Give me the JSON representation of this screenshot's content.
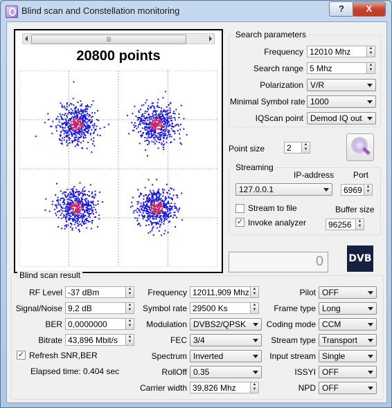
{
  "window": {
    "title": "Blind scan and Constellation monitoring",
    "help_glyph": "?",
    "close_glyph": "X"
  },
  "plot": {
    "points_label": "20800 points",
    "scroll_grip": "|||"
  },
  "search": {
    "group_title": "Search parameters",
    "frequency_label": "Frequency",
    "frequency_value": "12010 Mhz",
    "range_label": "Search range",
    "range_value": "5 Mhz",
    "polarization_label": "Polarization",
    "polarization_value": "V/R",
    "minsr_label": "Minimal Symbol rate",
    "minsr_value": "1000",
    "iqscan_label": "IQScan point",
    "iqscan_value": "Demod IQ out"
  },
  "point_size": {
    "label": "Point size",
    "value": "2"
  },
  "streaming": {
    "group_title": "Streaming",
    "ip_label": "IP-address",
    "port_label": "Port",
    "ip_value": "127.0.0.1",
    "port_value": "6969",
    "stream_to_file_label": "Stream to file",
    "stream_to_file_checked": false,
    "invoke_analyzer_label": "Invoke analyzer",
    "invoke_analyzer_checked": true,
    "buffer_size_label": "Buffer size",
    "buffer_size_value": "96256"
  },
  "status": {
    "value": "0",
    "logo": "DVB"
  },
  "result": {
    "group_title": "Blind scan result",
    "rf_level_label": "RF Level",
    "rf_level_value": "-37 dBm",
    "snr_label": "Signal/Noise",
    "snr_value": "9,2 dB",
    "ber_label": "BER",
    "ber_value": "0,0000000",
    "bitrate_label": "Bitrate",
    "bitrate_value": "43,896 Mbit/s",
    "refresh_label": "Refresh SNR,BER",
    "refresh_checked": true,
    "elapsed": "Elapsed time: 0.404 sec",
    "frequency_label": "Frequency",
    "frequency_value": "12011,909 Mhz",
    "symbol_rate_label": "Symbol rate",
    "symbol_rate_value": "29500 Ks",
    "modulation_label": "Modulation",
    "modulation_value": "DVBS2/QPSK",
    "fec_label": "FEC",
    "fec_value": "3/4",
    "spectrum_label": "Spectrum",
    "spectrum_value": "Inverted",
    "rolloff_label": "RollOff",
    "rolloff_value": "0.35",
    "carrier_width_label": "Carrier width",
    "carrier_width_value": "39,826 Mhz",
    "pilot_label": "Pilot",
    "pilot_value": "OFF",
    "frame_type_label": "Frame type",
    "frame_type_value": "Long",
    "coding_mode_label": "Coding mode",
    "coding_mode_value": "CCM",
    "stream_type_label": "Stream type",
    "stream_type_value": "Transport",
    "input_stream_label": "Input stream",
    "input_stream_value": "Single",
    "issyi_label": "ISSYI",
    "issyi_value": "OFF",
    "npd_label": "NPD",
    "npd_value": "OFF"
  },
  "colors": {
    "point_outer": "#1a1ad8",
    "point_core": "#c0286a",
    "grid": "#b0b0b0"
  }
}
